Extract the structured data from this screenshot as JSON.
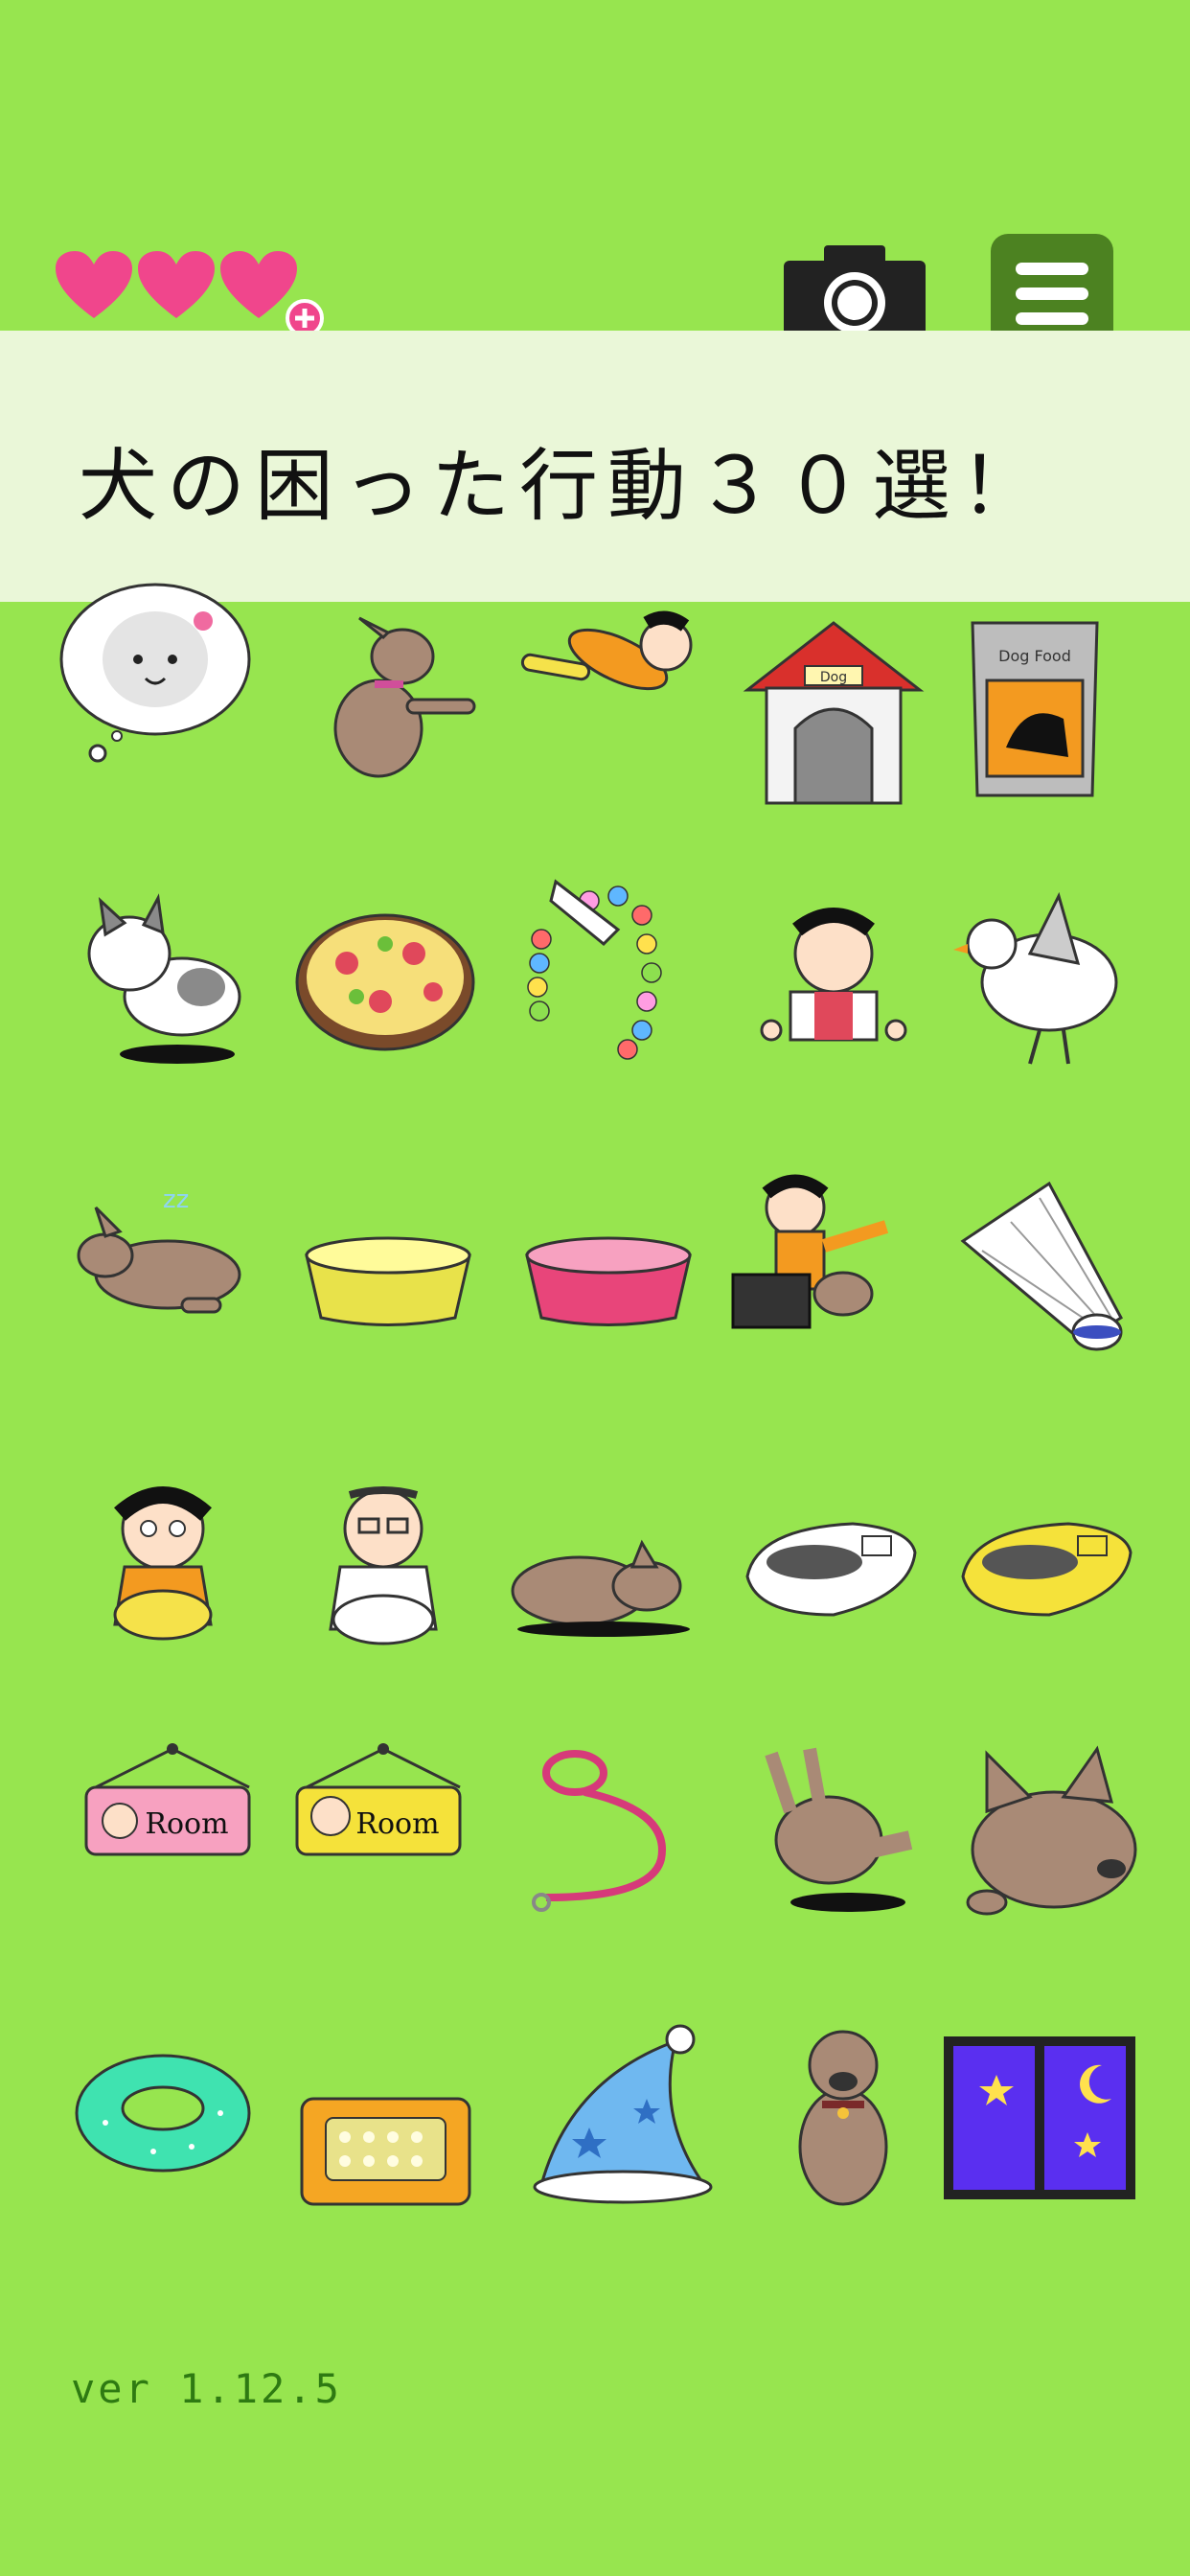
{
  "header": {
    "hearts": [
      "heart-icon",
      "heart-icon",
      "heart-icon"
    ],
    "add_life_icon": "plus-badge-icon",
    "camera_icon": "camera-icon",
    "menu_icon": "hamburger-menu-icon"
  },
  "title": "犬の困った行動３０選！",
  "items": [
    "thought-bubble-poodle",
    "dog-begging",
    "kid-diving",
    "dog-house",
    "dog-food-bag",
    "cat",
    "pizza",
    "balloon-seven",
    "kid-reaching",
    "white-bird",
    "dog-sleeping",
    "yellow-bowl",
    "pink-bowl",
    "kid-pointing-dog-box",
    "shuttlecock",
    "girl-sitting",
    "grandpa-sitting",
    "dog-lying",
    "white-shoe",
    "yellow-shoe",
    "pink-room-sign",
    "yellow-room-sign",
    "pink-leash",
    "dog-digging",
    "dog-face-resting",
    "swim-ring",
    "pet-bed",
    "star-nightcap",
    "dog-sitting",
    "night-window"
  ],
  "room_sign_text": "Room",
  "dog_house_label": "Dog",
  "food_bag_label": "Dog Food",
  "version": "ver 1.12.5",
  "colors": {
    "background": "#97e54f",
    "heart": "#f0468c",
    "menu": "#4c8221",
    "banner": "#eaf7d8"
  }
}
